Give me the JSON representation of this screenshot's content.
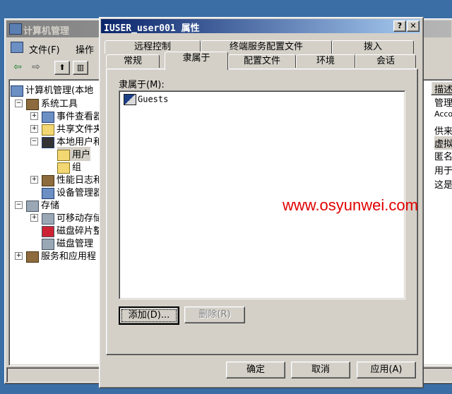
{
  "background_window": {
    "title": "计算机管理",
    "menu": [
      "文件(F)",
      "操作"
    ],
    "toolbar_icons": [
      "back-arrow-icon",
      "forward-arrow-icon",
      "up-folder-icon",
      "show-tree-icon"
    ],
    "tree": [
      {
        "label": "计算机管理(本地",
        "icon": "computer-icon"
      },
      {
        "label": "系统工具",
        "icon": "tools-icon"
      },
      {
        "label": "事件查看器",
        "icon": "event-viewer-icon"
      },
      {
        "label": "共享文件夹",
        "icon": "shared-folder-icon"
      },
      {
        "label": "本地用户和组",
        "icon": "users-icon"
      },
      {
        "label": "用户",
        "icon": "folder-open-icon"
      },
      {
        "label": "组",
        "icon": "folder-icon"
      },
      {
        "label": "性能日志和",
        "icon": "performance-icon"
      },
      {
        "label": "设备管理器",
        "icon": "device-manager-icon"
      },
      {
        "label": "存储",
        "icon": "storage-icon"
      },
      {
        "label": "可移动存储",
        "icon": "removable-storage-icon"
      },
      {
        "label": "磁盘碎片整",
        "icon": "defrag-icon"
      },
      {
        "label": "磁盘管理",
        "icon": "disk-management-icon"
      },
      {
        "label": "服务和应用程",
        "icon": "services-icon"
      }
    ],
    "right_header": "描述",
    "right_rows": [
      "管理",
      "Acco",
      "供来",
      "虚拟",
      "匿名",
      "用于",
      "这是"
    ]
  },
  "dialog": {
    "title": "IUSER_user001 属性",
    "help_button": "?",
    "close_button": "✕",
    "tabs_back": [
      "远程控制",
      "终端服务配置文件",
      "拨入"
    ],
    "tabs_front": [
      "常规",
      "隶属于",
      "配置文件",
      "环境",
      "会话"
    ],
    "active_tab": "隶属于",
    "member_of_label": "隶属于(M):",
    "members": [
      "Guests"
    ],
    "add_button": "添加(D)...",
    "remove_button": "删除(R)",
    "ok_button": "确定",
    "cancel_button": "取消",
    "apply_button": "应用(A)"
  },
  "watermark": "www.osyunwei.com"
}
